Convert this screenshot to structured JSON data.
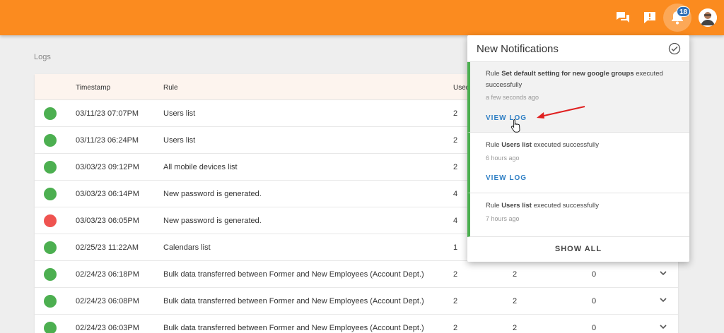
{
  "header": {
    "notification_count": "18",
    "colors": {
      "bar": "#fb8b1f",
      "badge": "#2f6fb5"
    },
    "icons": [
      "chat-icon",
      "feedback-icon",
      "bell-icon",
      "avatar"
    ]
  },
  "page": {
    "label": "Logs"
  },
  "table": {
    "columns": [
      "Timestamp",
      "Rule",
      "Used"
    ],
    "rows": [
      {
        "status": "success",
        "timestamp": "03/11/23 07:07PM",
        "rule": "Users list",
        "c1": "2",
        "c2": "",
        "c3": ""
      },
      {
        "status": "success",
        "timestamp": "03/11/23 06:24PM",
        "rule": "Users list",
        "c1": "2",
        "c2": "",
        "c3": ""
      },
      {
        "status": "success",
        "timestamp": "03/03/23 09:12PM",
        "rule": "All mobile devices list",
        "c1": "2",
        "c2": "",
        "c3": ""
      },
      {
        "status": "success",
        "timestamp": "03/03/23 06:14PM",
        "rule": "New password is generated.",
        "c1": "4",
        "c2": "",
        "c3": ""
      },
      {
        "status": "error",
        "timestamp": "03/03/23 06:05PM",
        "rule": "New password is generated.",
        "c1": "4",
        "c2": "",
        "c3": ""
      },
      {
        "status": "success",
        "timestamp": "02/25/23 11:22AM",
        "rule": "Calendars list",
        "c1": "1",
        "c2": "",
        "c3": ""
      },
      {
        "status": "success",
        "timestamp": "02/24/23 06:18PM",
        "rule": "Bulk data transferred between Former and New Employees (Account Dept.)",
        "c1": "2",
        "c2": "2",
        "c3": "0"
      },
      {
        "status": "success",
        "timestamp": "02/24/23 06:08PM",
        "rule": "Bulk data transferred between Former and New Employees (Account Dept.)",
        "c1": "2",
        "c2": "2",
        "c3": "0"
      },
      {
        "status": "success",
        "timestamp": "02/24/23 06:03PM",
        "rule": "Bulk data transferred between Former and New Employees (Account Dept.)",
        "c1": "2",
        "c2": "2",
        "c3": "0"
      }
    ],
    "status_colors": {
      "success": "#4caf50",
      "error": "#ef5350"
    }
  },
  "notifications": {
    "title": "New Notifications",
    "items": [
      {
        "prefix": "Rule ",
        "rule": "Set default setting for new google groups",
        "suffix": " executed successfully",
        "time": "a few seconds ago",
        "action": "VIEW LOG"
      },
      {
        "prefix": "Rule ",
        "rule": "Users list",
        "suffix": " executed successfully",
        "time": "6 hours ago",
        "action": "VIEW LOG"
      },
      {
        "prefix": "Rule ",
        "rule": "Users list",
        "suffix": " executed successfully",
        "time": "7 hours ago"
      }
    ],
    "show_all": "SHOW ALL"
  }
}
